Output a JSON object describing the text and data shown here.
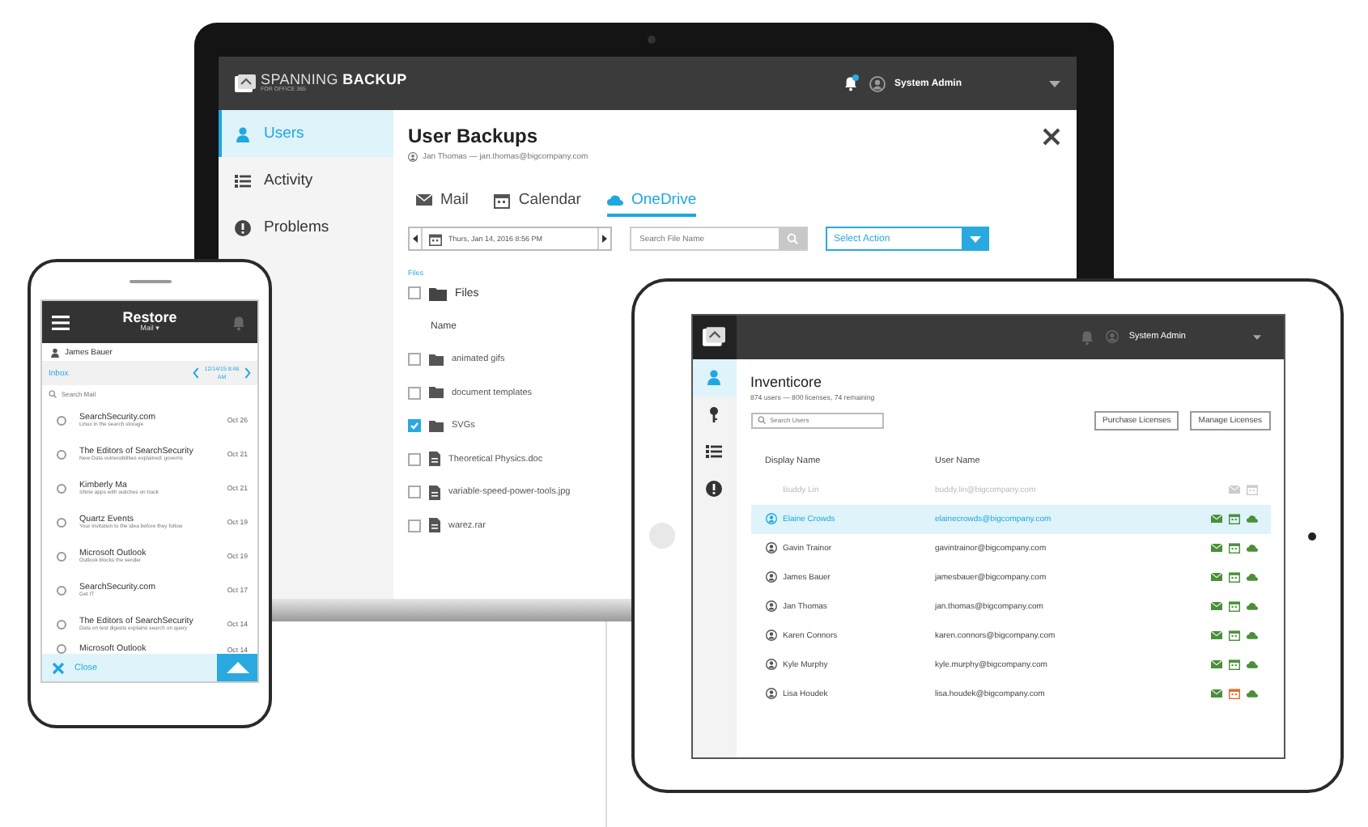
{
  "laptop": {
    "logo": {
      "name": "SPANNING **BACKUP**",
      "tagline": "FOR OFFICE 365"
    },
    "user": "System Admin",
    "nav": [
      {
        "label": "Users",
        "selected": true
      },
      {
        "label": "Activity",
        "selected": false
      },
      {
        "label": "Problems",
        "selected": false
      }
    ],
    "title": "User Backups",
    "subtitle": "Jan Thomas — jan.thomas@bigcompany.com",
    "tabs": [
      {
        "label": "Mail",
        "selected": false
      },
      {
        "label": "Calendar",
        "selected": false
      },
      {
        "label": "OneDrive",
        "selected": true
      }
    ],
    "date": "Thurs, Jan 14, 2016 8:56 PM",
    "search": {
      "placeholder": "Search File Name"
    },
    "action": {
      "placeholder": "Select Action"
    },
    "breadcrumb": "Files",
    "folder": {
      "label": "Files",
      "checked": false
    },
    "column": "Name",
    "files": [
      {
        "name": "animated gifs",
        "kind": "folder",
        "checked": false
      },
      {
        "name": "document templates",
        "kind": "folder",
        "checked": false
      },
      {
        "name": "SVGs",
        "kind": "folder",
        "checked": true
      },
      {
        "name": "Theoretical Physics.doc",
        "kind": "file",
        "checked": false
      },
      {
        "name": "variable-speed-power-tools.jpg",
        "kind": "file",
        "checked": false
      },
      {
        "name": "warez.rar",
        "kind": "file",
        "checked": false
      }
    ]
  },
  "phone": {
    "title": "Restore",
    "subtitle": "Mail ▾",
    "user": "James Bauer",
    "folder": "Inbox",
    "date": "12/14/15 8:46 AM",
    "search": {
      "placeholder": "Search Mail"
    },
    "messages": [
      {
        "sender": "SearchSecurity.com",
        "subject": "Linux in the search storage",
        "date": "Oct 26"
      },
      {
        "sender": "The Editors of SearchSecurity",
        "subject": "New Data vulnerabilities explained: governs",
        "date": "Oct 21"
      },
      {
        "sender": "Kimberly Ma",
        "subject": "Shine apps with watches on track",
        "date": "Oct 21"
      },
      {
        "sender": "Quartz Events",
        "subject": "Your invitation to the idea before they follow",
        "date": "Oct 19"
      },
      {
        "sender": "Microsoft Outlook",
        "subject": "Outlook blocks the sender",
        "date": "Oct 19"
      },
      {
        "sender": "SearchSecurity.com",
        "subject": "Get IT",
        "date": "Oct 17"
      },
      {
        "sender": "The Editors of SearchSecurity",
        "subject": "Data on test digests explains search on query",
        "date": "Oct 14"
      },
      {
        "sender": "Microsoft Outlook",
        "date": "Oct 14"
      }
    ],
    "close": "Close"
  },
  "tablet": {
    "user": "System Admin",
    "nav": [
      {
        "selected": true
      },
      {
        "selected": false
      },
      {
        "selected": false
      },
      {
        "selected": false
      }
    ],
    "title": "Inventicore",
    "subtitle": "874 users — 800 licenses, 74 remaining",
    "search": {
      "placeholder": "Search Users"
    },
    "buttons": [
      "Purchase Licenses",
      "Manage Licenses"
    ],
    "columns": [
      "Display Name",
      "User Name"
    ],
    "rows": [
      {
        "name": "Buddy Lin",
        "email": "buddy.lin@bigcompany.com",
        "selected": false,
        "disabled": true,
        "calendar_alert": false
      },
      {
        "name": "Elaine Crowds",
        "email": "elainecrowds@bigcompany.com",
        "selected": true,
        "disabled": false,
        "calendar_alert": false
      },
      {
        "name": "Gavin Trainor",
        "email": "gavintrainor@bigcompany.com",
        "selected": false,
        "disabled": false,
        "calendar_alert": false
      },
      {
        "name": "James Bauer",
        "email": "jamesbauer@bigcompany.com",
        "selected": false,
        "disabled": false,
        "calendar_alert": false
      },
      {
        "name": "Jan Thomas",
        "email": "jan.thomas@bigcompany.com",
        "selected": false,
        "disabled": false,
        "calendar_alert": false
      },
      {
        "name": "Karen Connors",
        "email": "karen.connors@bigcompany.com",
        "selected": false,
        "disabled": false,
        "calendar_alert": false
      },
      {
        "name": "Kyle Murphy",
        "email": "kyle.murphy@bigcompany.com",
        "selected": false,
        "disabled": false,
        "calendar_alert": false
      },
      {
        "name": "Lisa Houdek",
        "email": "lisa.houdek@bigcompany.com",
        "selected": false,
        "disabled": false,
        "calendar_alert": true
      }
    ]
  }
}
